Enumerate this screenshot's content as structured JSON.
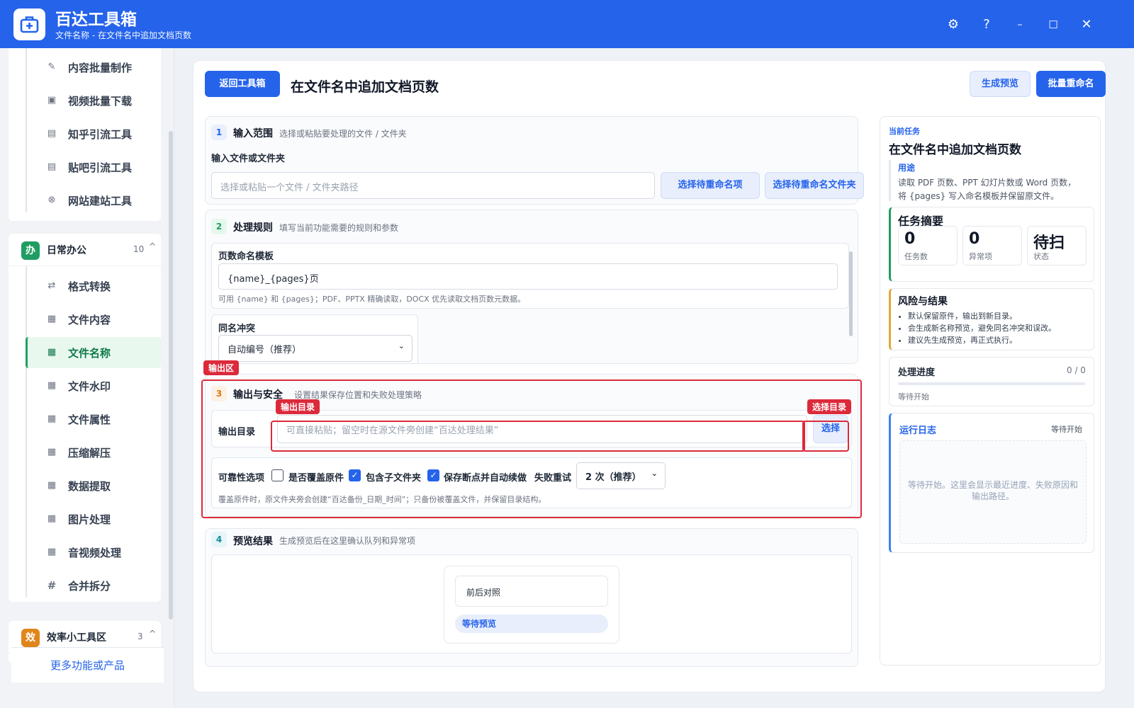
{
  "app": {
    "title": "百达工具箱",
    "subtitle": "文件名称 - 在文件名中追加文档页数"
  },
  "window_controls": [
    "⚙",
    "?",
    "–",
    "☐",
    "✕"
  ],
  "sidebar": {
    "items_top": [
      {
        "label": "内容批量制作",
        "icon": "pen-icon"
      },
      {
        "label": "视频批量下载",
        "icon": "video-icon"
      },
      {
        "label": "知乎引流工具",
        "icon": "doc-icon"
      },
      {
        "label": "贴吧引流工具",
        "icon": "doc-icon"
      },
      {
        "label": "网站建站工具",
        "icon": "globe-icon"
      }
    ],
    "group_office": {
      "badge": "办",
      "name": "日常办公",
      "count": "10",
      "chevron": "^",
      "items": [
        {
          "label": "格式转换",
          "icon": "swap-icon"
        },
        {
          "label": "文件内容",
          "icon": "grid-icon"
        },
        {
          "label": "文件名称",
          "icon": "grid-icon",
          "active": true
        },
        {
          "label": "文件水印",
          "icon": "grid-icon"
        },
        {
          "label": "文件属性",
          "icon": "grid-icon"
        },
        {
          "label": "压缩解压",
          "icon": "grid-icon"
        },
        {
          "label": "数据提取",
          "icon": "grid-icon"
        },
        {
          "label": "图片处理",
          "icon": "grid-icon"
        },
        {
          "label": "音视频处理",
          "icon": "grid-icon"
        },
        {
          "label": "合并拆分",
          "icon": "hash-icon"
        }
      ]
    },
    "group_efficiency": {
      "badge": "效",
      "name": "效率小工具区",
      "count": "3",
      "chevron": "^"
    },
    "bottom_link": "更多功能或产品"
  },
  "header": {
    "back_button": "返回工具箱",
    "title": "在文件名中追加文档页数",
    "preview_button": "生成预览",
    "rename_button": "批量重命名"
  },
  "sections": {
    "input": {
      "num": "1",
      "title": "输入范围",
      "desc": "选择或粘贴要处理的文件 / 文件夹",
      "field_label": "输入文件或文件夹",
      "placeholder": "选择或粘贴一个文件 / 文件夹路径",
      "btn_items": "选择待重命名项",
      "btn_folder": "选择待重命名文件夹"
    },
    "rules": {
      "num": "2",
      "title": "处理规则",
      "desc": "填写当前功能需要的规则和参数",
      "template_label": "页数命名模板",
      "template_value": "{name}_{pages}页",
      "template_hint": "可用 {name} 和 {pages}；PDF、PPTX 精确读取，DOCX 优先读取文档页数元数据。",
      "conflict_label": "同名冲突",
      "conflict_value": "自动编号（推荐）"
    },
    "output": {
      "num": "3",
      "title": "输出与安全",
      "desc": "设置结果保存位置和失败处理策略",
      "dir_label": "输出目录",
      "dir_placeholder": "可直接粘贴；留空时在源文件旁创建“百达处理结果”",
      "select_button": "选择",
      "reliability_label": "可靠性选项",
      "opt_overwrite": "是否覆盖原件",
      "opt_overwrite_checked": false,
      "opt_subfolders": "包含子文件夹",
      "opt_subfolders_checked": true,
      "opt_resume": "保存断点并自动续做",
      "opt_resume_checked": true,
      "retry_label": "失败重试",
      "retry_value": "2 次（推荐）",
      "hint": "覆盖原件时，原文件夹旁会创建“百达备份_日期_时间”；只备份被覆盖文件，并保留目录结构。"
    },
    "preview": {
      "num": "4",
      "title": "预览结果",
      "desc": "生成预览后在这里确认队列和异常项",
      "compare_label": "前后对照",
      "status_badge": "等待预览"
    }
  },
  "annotations": {
    "output_zone": "输出区",
    "output_dir": "输出目录",
    "select_dir": "选择目录"
  },
  "right_panel": {
    "task_kicker": "当前任务",
    "task_title": "在文件名中追加文档页数",
    "usage_title": "用途",
    "usage_text_1": "读取 PDF 页数、PPT 幻灯片数或 Word 页数，",
    "usage_text_2": "将 {pages} 写入命名模板并保留原文件。",
    "summary_title": "任务摘要",
    "stats": [
      {
        "value": "0",
        "label": "任务数"
      },
      {
        "value": "0",
        "label": "异常项"
      },
      {
        "value": "待扫",
        "label": "状态"
      }
    ],
    "risk_title": "风险与结果",
    "risk_items": [
      "默认保留原件，输出到新目录。",
      "会生成新名称预览，避免同名冲突和误改。",
      "建议先生成预览，再正式执行。"
    ],
    "progress_title": "处理进度",
    "progress_count": "0 / 0",
    "progress_fraction": 0,
    "progress_status": "等待开始",
    "log_title": "运行日志",
    "log_status": "等待开始",
    "log_placeholder_1": "等待开始。这里会显示最近进度、失败原因和",
    "log_placeholder_2": "输出路径。"
  },
  "colors": {
    "primary": "#2563eb",
    "active_green": "#22a061",
    "highlight_red": "#dc2a3b",
    "badge_office": "#1f9d62",
    "badge_efficiency": "#e0851b"
  }
}
